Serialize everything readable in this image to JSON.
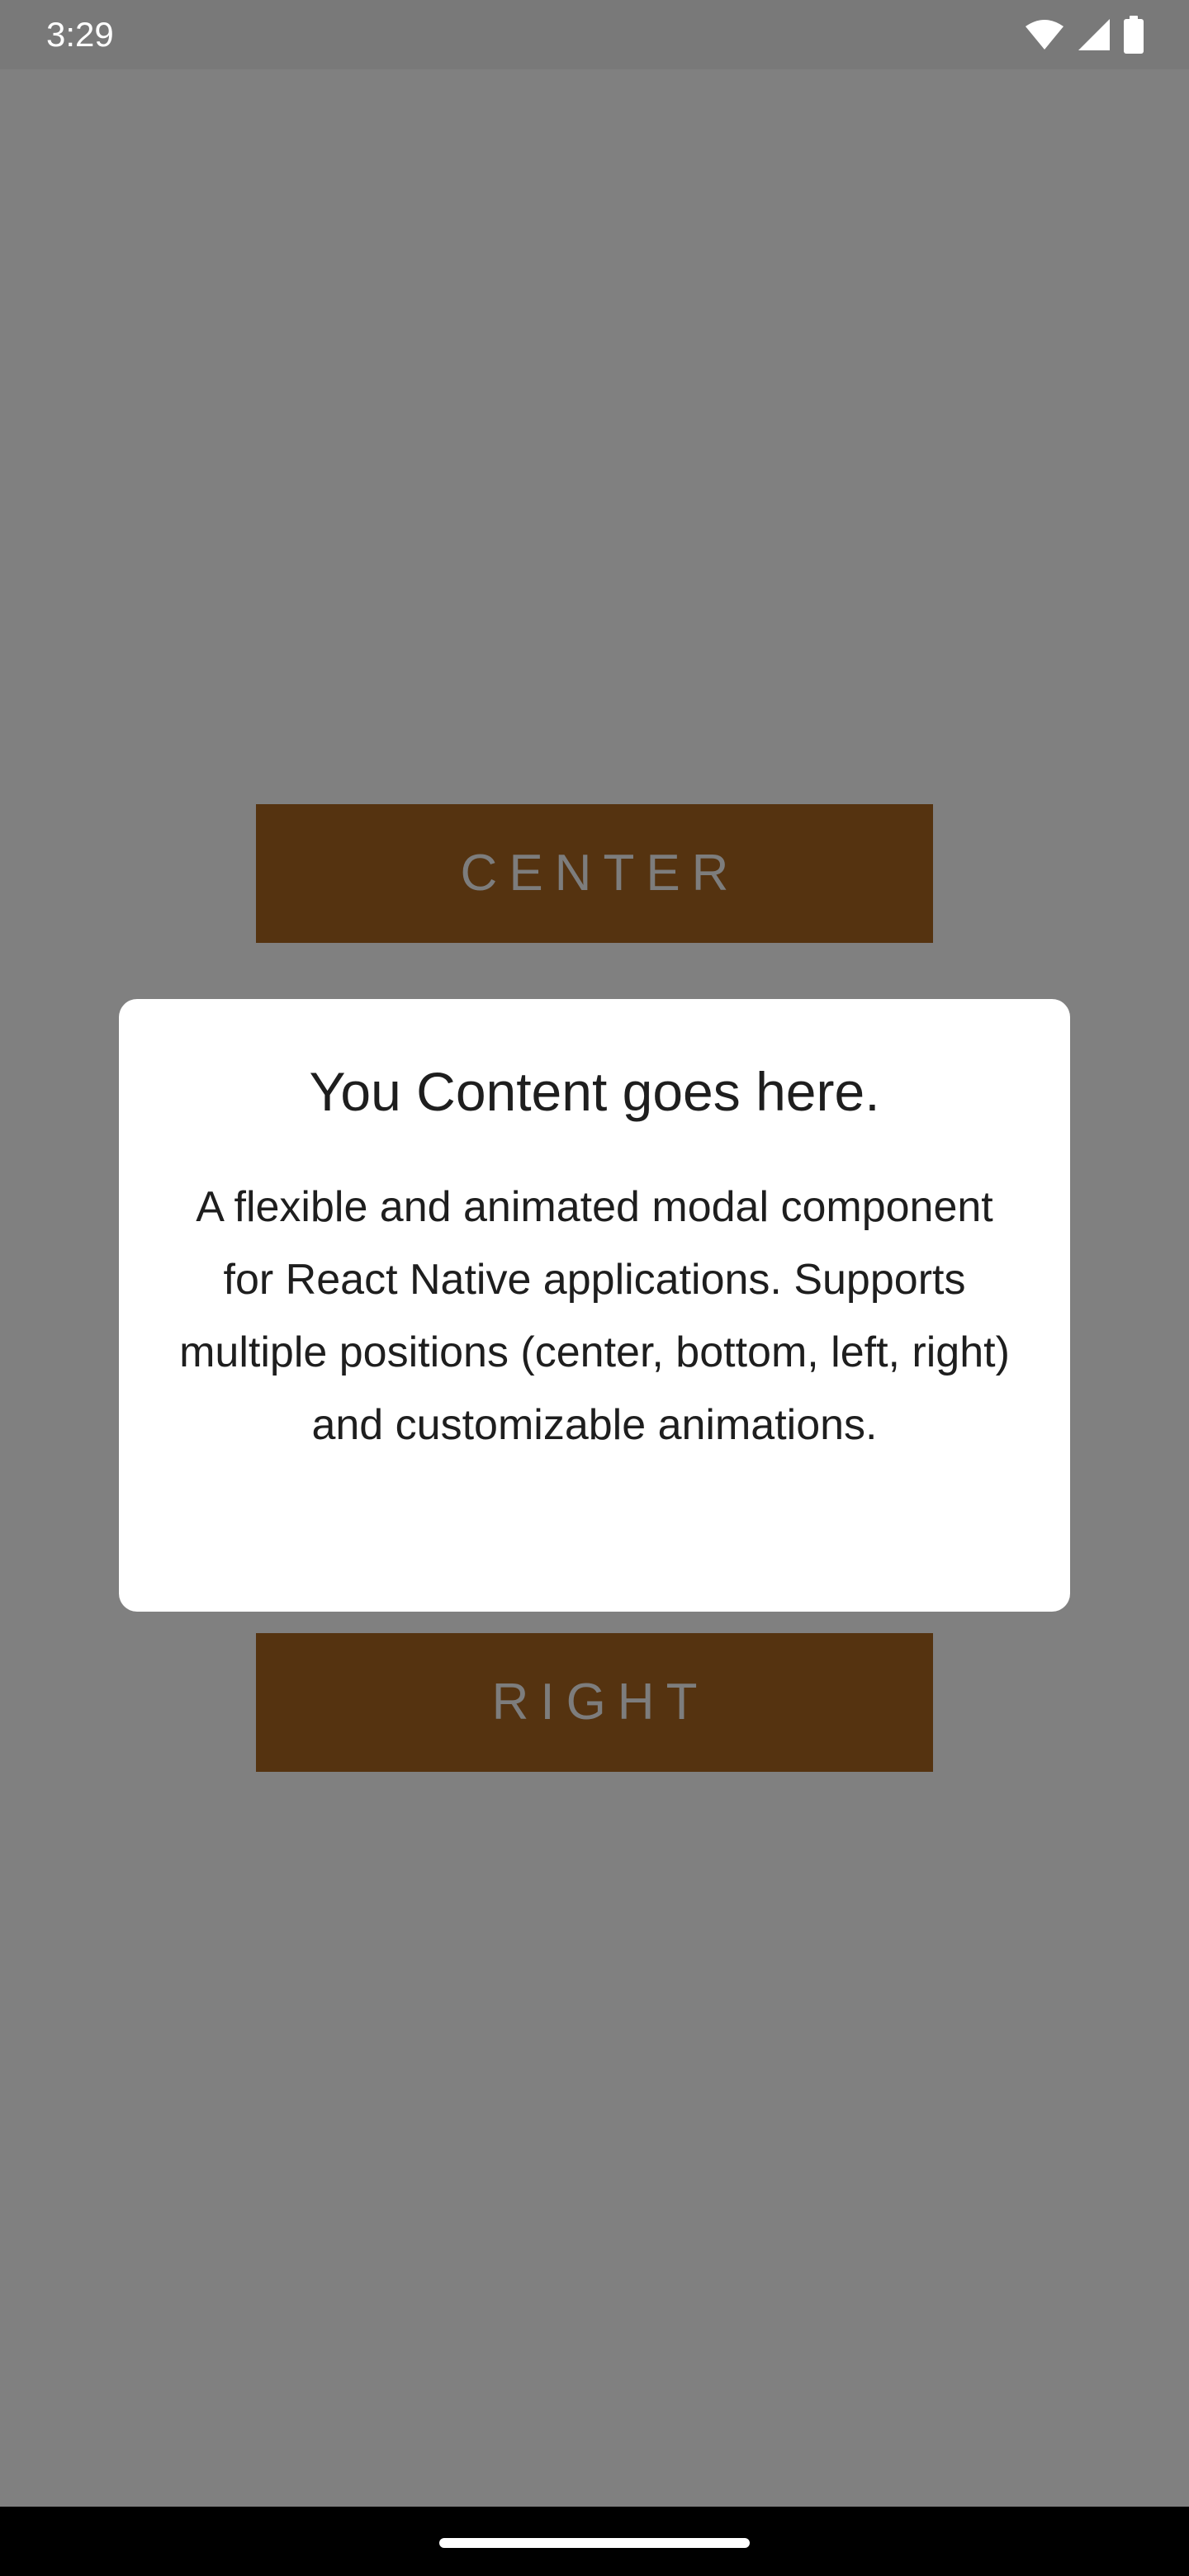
{
  "status_bar": {
    "time": "3:29",
    "icons": [
      "wifi-icon",
      "cell-signal-icon",
      "battery-icon"
    ]
  },
  "buttons": {
    "center_label": "CENTER",
    "right_label": "RIGHT"
  },
  "modal": {
    "title": "You Content goes here.",
    "body": "A flexible and animated modal component for React Native applications. Supports multiple positions (center, bottom, left, right) and customizable animations."
  },
  "colors": {
    "backdrop": "#808080",
    "button_bg": "#553310",
    "button_text": "#7d7d7d",
    "modal_bg": "#ffffff",
    "modal_text": "#1e1e1e"
  }
}
